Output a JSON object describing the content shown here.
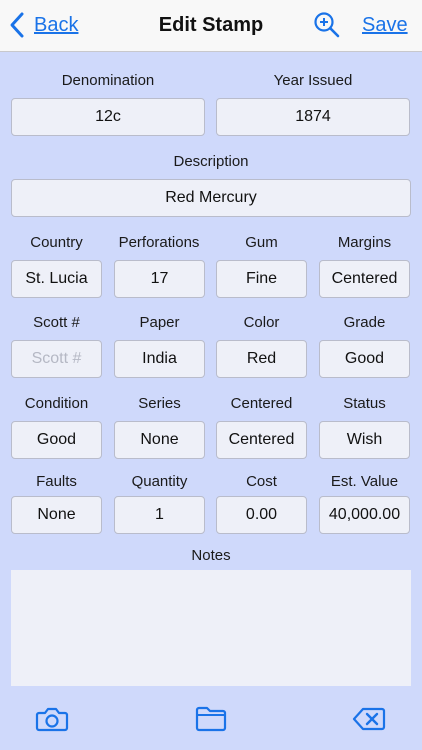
{
  "nav": {
    "back_label": "Back",
    "title": "Edit Stamp",
    "save_label": "Save"
  },
  "accent_color": "#1a73e8",
  "icons": [
    "chevron-left-icon",
    "zoom-in-icon",
    "camera-icon",
    "folder-icon",
    "delete-backspace-icon"
  ],
  "fields": {
    "denomination": {
      "label": "Denomination",
      "value": "12c"
    },
    "year_issued": {
      "label": "Year Issued",
      "value": "1874"
    },
    "description": {
      "label": "Description",
      "value": "Red Mercury"
    },
    "country": {
      "label": "Country",
      "value": "St. Lucia"
    },
    "perforations": {
      "label": "Perforations",
      "value": "17"
    },
    "gum": {
      "label": "Gum",
      "value": "Fine"
    },
    "margins": {
      "label": "Margins",
      "value": "Centered"
    },
    "scott": {
      "label": "Scott #",
      "value": "",
      "placeholder": "Scott #"
    },
    "paper": {
      "label": "Paper",
      "value": "India"
    },
    "color": {
      "label": "Color",
      "value": "Red"
    },
    "grade": {
      "label": "Grade",
      "value": "Good"
    },
    "condition": {
      "label": "Condition",
      "value": "Good"
    },
    "series": {
      "label": "Series",
      "value": "None"
    },
    "centered": {
      "label": "Centered",
      "value": "Centered"
    },
    "status": {
      "label": "Status",
      "value": "Wish"
    },
    "faults": {
      "label": "Faults",
      "value": "None"
    },
    "quantity": {
      "label": "Quantity",
      "value": "1"
    },
    "cost": {
      "label": "Cost",
      "value": "0.00"
    },
    "est_value": {
      "label": "Est. Value",
      "value": "40,000.00"
    },
    "notes": {
      "label": "Notes",
      "value": ""
    }
  }
}
